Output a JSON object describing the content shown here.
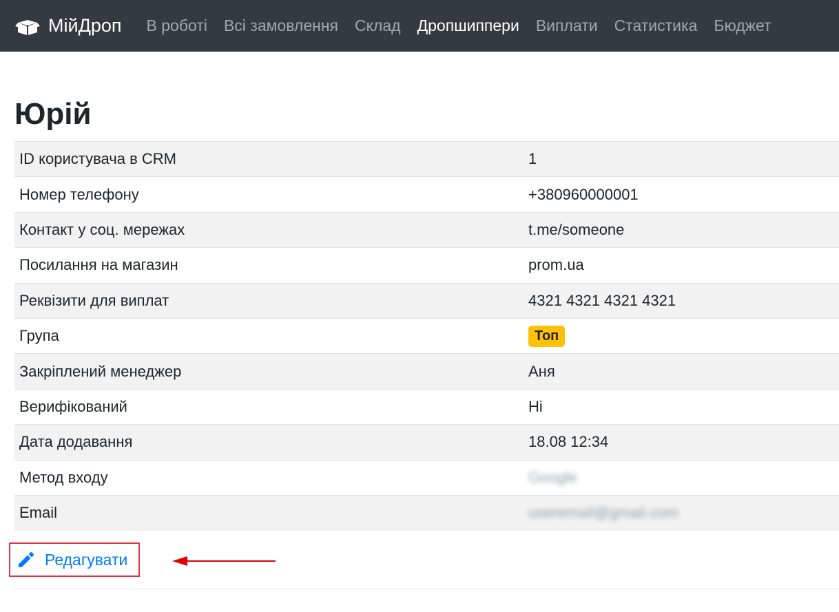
{
  "brand": {
    "name": "МійДроп",
    "icon": "open-box-icon"
  },
  "nav": [
    {
      "label": "В роботі",
      "active": false
    },
    {
      "label": "Всі замовлення",
      "active": false
    },
    {
      "label": "Склад",
      "active": false
    },
    {
      "label": "Дропшиппери",
      "active": true
    },
    {
      "label": "Виплати",
      "active": false
    },
    {
      "label": "Статистика",
      "active": false
    },
    {
      "label": "Бюджет",
      "active": false
    }
  ],
  "page": {
    "title": "Юрій"
  },
  "details": [
    {
      "key": "ID користувача в CRM",
      "value": "1"
    },
    {
      "key": "Номер телефону",
      "value": "+380960000001"
    },
    {
      "key": "Контакт у соц. мережах",
      "value": "t.me/someone"
    },
    {
      "key": "Посилання на магазин",
      "value": "prom.ua"
    },
    {
      "key": "Реквізити для виплат",
      "value": "4321 4321 4321 4321"
    },
    {
      "key": "Група",
      "value": "Топ",
      "badge_color": "#ffc107"
    },
    {
      "key": "Закріплений менеджер",
      "value": "Аня"
    },
    {
      "key": "Верифікований",
      "value": "Ні"
    },
    {
      "key": "Дата додавання",
      "value": "18.08 12:34"
    },
    {
      "key": "Метод входу",
      "value": "Google"
    },
    {
      "key": "Email",
      "value": "useremail@gmail.com"
    }
  ],
  "actions": {
    "edit_label": "Редагувати",
    "edit_icon": "pencil-icon"
  },
  "colors": {
    "navbar_bg": "#343a40",
    "link": "#007bff",
    "highlight": "#dc3545",
    "badge": "#ffc107"
  }
}
